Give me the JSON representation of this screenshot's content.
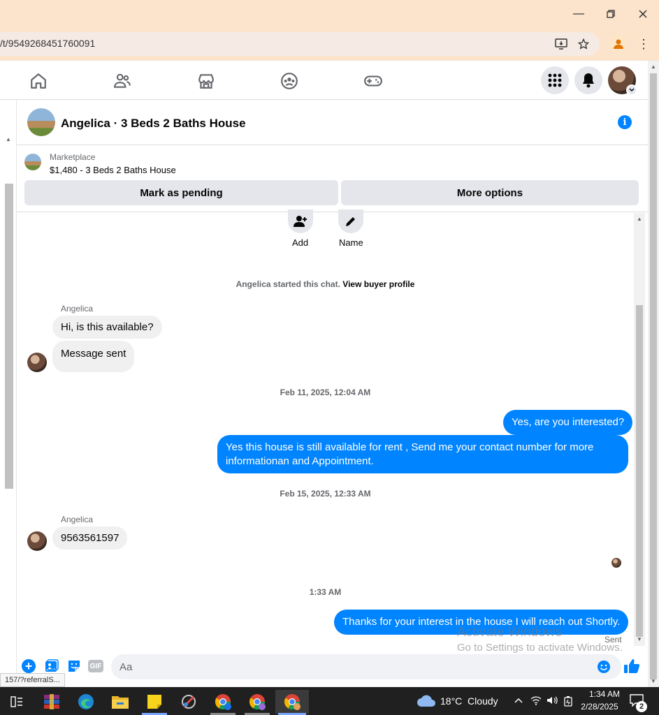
{
  "browser": {
    "url": "/t/9549268451760091",
    "status_url": "157/?referralS..."
  },
  "header": {
    "title": "Angelica · 3 Beds 2 Baths House"
  },
  "marketplace": {
    "label": "Marketplace",
    "listing": "$1,480 - 3 Beds 2 Baths House",
    "mark_pending": "Mark as pending",
    "more_options": "More options"
  },
  "actions": {
    "add": "Add",
    "name": "Name"
  },
  "chat": {
    "started_text": "Angelica started this chat.",
    "view_profile": "View buyer profile",
    "sender1": "Angelica",
    "msg1": "Hi, is this available?",
    "msg2": "Message sent",
    "ts1": "Feb 11, 2025, 12:04 AM",
    "out1": "Yes, are you interested?",
    "out2": "Yes this house is still available for rent , Send me your contact number for more informationan and Appointment.",
    "ts2": "Feb 15, 2025, 12:33 AM",
    "sender2": "Angelica",
    "msg3": "9563561597",
    "ts3": "1:33 AM",
    "out3": "Thanks for your interest in the house I will reach out Shortly.",
    "sent": "Sent"
  },
  "composer": {
    "placeholder": "Aa",
    "gif": "GIF"
  },
  "watermark": {
    "line1": "Activate Windows",
    "line2": "Go to Settings to activate Windows."
  },
  "taskbar": {
    "weather": "18°C  Cloudy",
    "time": "1:34 AM",
    "date": "2/28/2025",
    "notif_count": "2"
  },
  "colors": {
    "accent": "#0084ff",
    "titlebar": "#fbe3cc"
  }
}
